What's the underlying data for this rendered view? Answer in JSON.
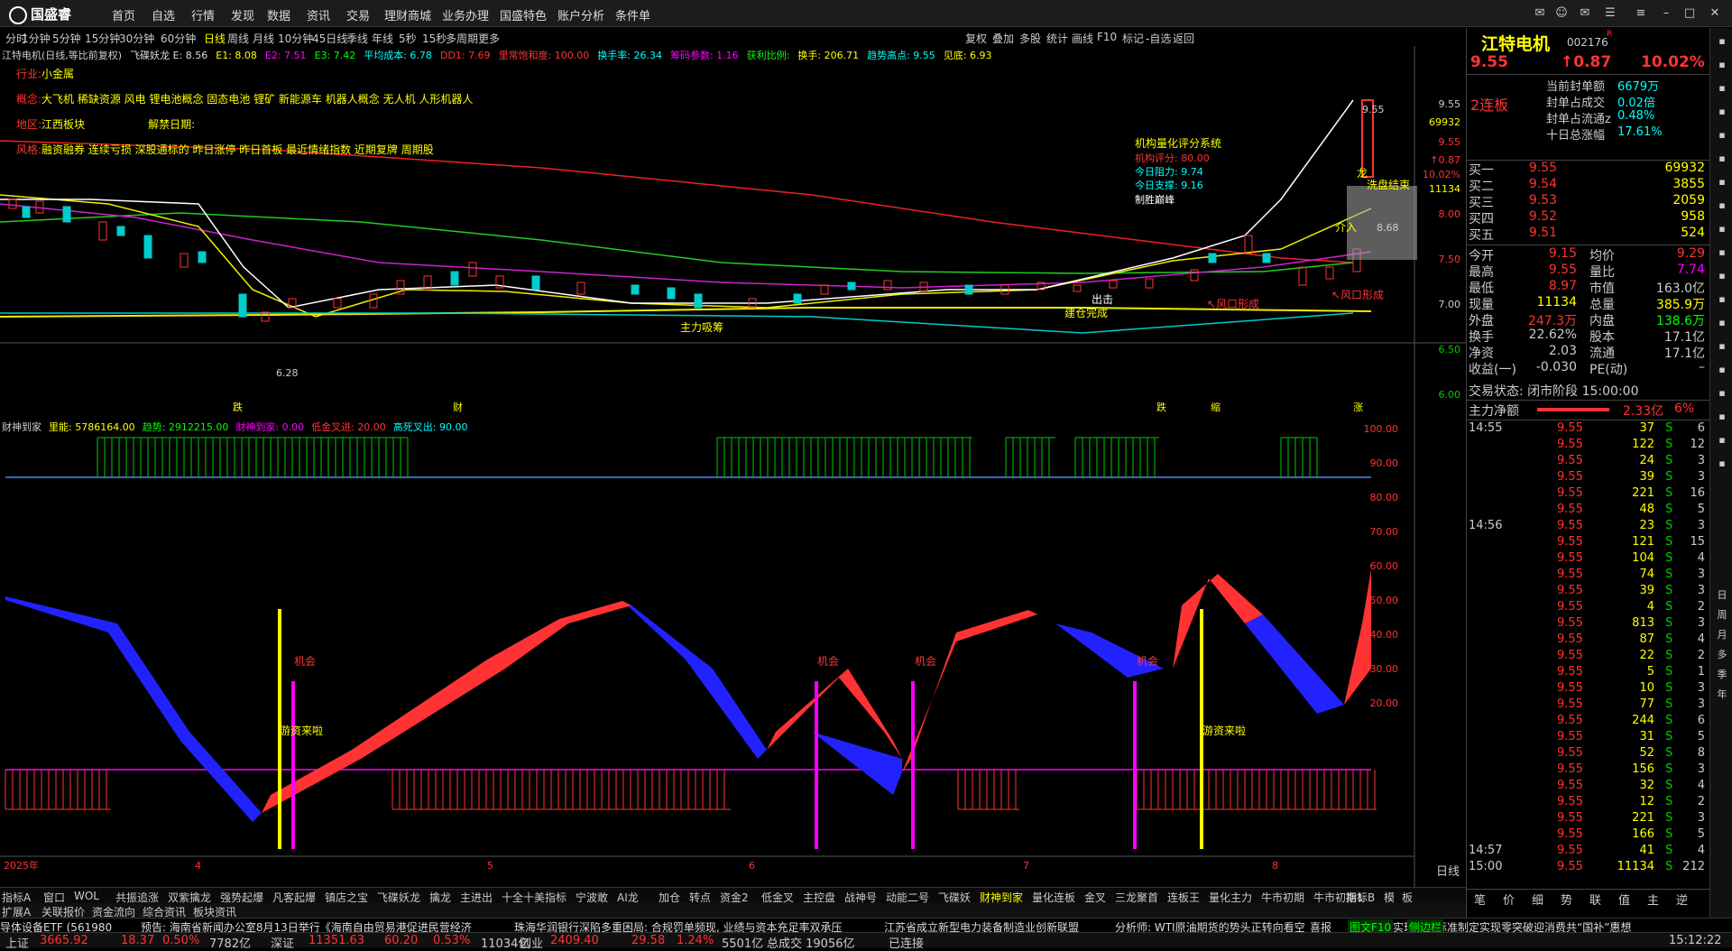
{
  "app": {
    "logo": "国盛睿",
    "menu": [
      "首页",
      "自选",
      "行情",
      "发现",
      "数据",
      "资讯",
      "交易",
      "理财商城",
      "业务办理",
      "国盛特色",
      "账户分析",
      "条件单"
    ]
  },
  "period_tabs": [
    "分时",
    "1分钟",
    "5分钟",
    "15分钟",
    "30分钟",
    "60分钟",
    "日线",
    "周线",
    "月线",
    "10分钟",
    "45日线",
    "季线",
    "年线",
    "5秒",
    "15秒",
    "多周期",
    "更多"
  ],
  "active_period": "日线",
  "toolbar": [
    "复权",
    "叠加",
    "多股",
    "统计",
    "画线",
    "F10",
    "标记",
    "-自选",
    "返回"
  ],
  "header_row": [
    {
      "t": "江特电机(日线,等比前复权)",
      "c": "#ccc"
    },
    {
      "t": "飞碟妖龙 E: 8.56",
      "c": "#ddd"
    },
    {
      "t": "E1: 8.08",
      "c": "#ff0"
    },
    {
      "t": "E2: 7.51",
      "c": "#f0f"
    },
    {
      "t": "E3: 7.42",
      "c": "#0f0"
    },
    {
      "t": "平均成本: 6.78",
      "c": "#0ff"
    },
    {
      "t": "DD1: 7.69",
      "c": "#f33"
    },
    {
      "t": "里常饱和度: 100.00",
      "c": "#f33"
    },
    {
      "t": "换手率: 26.34",
      "c": "#0ff"
    },
    {
      "t": "筹码参数: 1.16",
      "c": "#f0f"
    },
    {
      "t": "获利比例:",
      "c": "#0f0"
    },
    {
      "t": "换手: 206.71",
      "c": "#ff0"
    },
    {
      "t": "趋势高点: 9.55",
      "c": "#0ff"
    },
    {
      "t": "见底: 6.93",
      "c": "#ff0"
    }
  ],
  "info_box": {
    "industry_label": "行业:",
    "industry": "小金属",
    "concept_label": "概念:",
    "concept": "大飞机 稀缺资源 风电 锂电池概念 固态电池 锂矿 新能源车 机器人概念 无人机 人形机器人",
    "region_label": "地区:",
    "region": "江西板块",
    "unlock_label": "解禁日期:",
    "style_label": "风格:",
    "style": "融资融券 连续亏损 深股通标的 昨日涨停 昨日首板 最近情绪指数 近期复牌 周期股"
  },
  "annotations": {
    "low": "6.28",
    "high": "9.55",
    "right_low": "8.68",
    "main_absorb": "主力吸筹",
    "build_zone": "建仓完成",
    "winds_a": "↖风口形成",
    "winds_b": "↖风口形成",
    "dragon": "龙",
    "wash_end": "洗盘结束",
    "cut_in": "介入",
    "cut_in2": "出击",
    "score_title": "机构量化评分系统",
    "score_1": "机构评分: 80.00",
    "score_2": "今日阻力: 9.74",
    "score_3": "今日支撑: 9.16",
    "score_4": "制胜巅峰",
    "fall_1": "跌",
    "fall_2": "财",
    "fall_3": "跌",
    "flag_1": "缩",
    "flag_2": "涨"
  },
  "price_axis": [
    "9.55",
    "69932",
    "9.55",
    "↑0.87",
    "10.02%",
    "11134",
    "8.00",
    "7.50",
    "7.00",
    "6.50",
    "6.00"
  ],
  "sub_header": [
    {
      "t": "财神到家",
      "c": "#ccc"
    },
    {
      "t": "里能: 5786164.00",
      "c": "#ff0"
    },
    {
      "t": "趋势: 2912215.00",
      "c": "#0f0"
    },
    {
      "t": "财神到家: 0.00",
      "c": "#f0f"
    },
    {
      "t": "低金叉进: 20.00",
      "c": "#f33"
    },
    {
      "t": "高死叉出: 90.00",
      "c": "#0ff"
    }
  ],
  "sub_axis": [
    "100.00",
    "90.00",
    "80.00",
    "70.00",
    "60.00",
    "50.00",
    "40.00",
    "30.00",
    "20.00"
  ],
  "sub_labels": {
    "chance": "机会",
    "funds_come": "游资来啦"
  },
  "date_axis": [
    "2025年",
    "4",
    "5",
    "6",
    "7",
    "8"
  ],
  "date_label_right": "日线",
  "stock": {
    "name": "江特电机",
    "code": "002176",
    "suffix": "R",
    "price": "9.55",
    "change": "↑0.87",
    "pct": "10.02%",
    "board": "2连板"
  },
  "limit_info": [
    {
      "l": "当前封单额",
      "v": "6679万"
    },
    {
      "l": "封单占成交",
      "v": "0.02倍"
    },
    {
      "l": "封单占流通z",
      "v": "0.48%"
    },
    {
      "l": "十日总涨幅",
      "v": "17.61%"
    }
  ],
  "order_book": [
    {
      "l": "买一",
      "p": "9.55",
      "v": "69932"
    },
    {
      "l": "买二",
      "p": "9.54",
      "v": "3855"
    },
    {
      "l": "买三",
      "p": "9.53",
      "v": "2059"
    },
    {
      "l": "买四",
      "p": "9.52",
      "v": "958"
    },
    {
      "l": "买五",
      "p": "9.51",
      "v": "524"
    }
  ],
  "stats": [
    {
      "l": "今开",
      "v": "9.15",
      "c": "#f33",
      "l2": "均价",
      "v2": "9.29",
      "c2": "#f33"
    },
    {
      "l": "最高",
      "v": "9.55",
      "c": "#f33",
      "l2": "量比",
      "v2": "7.74",
      "c2": "#f0f"
    },
    {
      "l": "最低",
      "v": "8.97",
      "c": "#f33",
      "l2": "市值",
      "v2": "163.0亿",
      "c2": "#ccc"
    },
    {
      "l": "现量",
      "v": "11134",
      "c": "#ff0",
      "l2": "总量",
      "v2": "385.9万",
      "c2": "#ff0"
    },
    {
      "l": "外盘",
      "v": "247.3万",
      "c": "#f33",
      "l2": "内盘",
      "v2": "138.6万",
      "c2": "#0f0"
    },
    {
      "l": "换手",
      "v": "22.62%",
      "c": "#ccc",
      "l2": "股本",
      "v2": "17.1亿",
      "c2": "#ccc"
    },
    {
      "l": "净资",
      "v": "2.03",
      "c": "#ccc",
      "l2": "流通",
      "v2": "17.1亿",
      "c2": "#ccc"
    },
    {
      "l": "收益(一)",
      "v": "-0.030",
      "c": "#ccc",
      "l2": "PE(动)",
      "v2": "–",
      "c2": "#ccc"
    }
  ],
  "trade_status": "交易状态: 闭市阶段 15:00:00",
  "net_main": {
    "l": "主力净额",
    "v": "2.33亿",
    "p": "6%"
  },
  "ticks": [
    {
      "t": "14:55",
      "p": "9.55",
      "v": "37",
      "s": "S",
      "n": "6"
    },
    {
      "t": "",
      "p": "9.55",
      "v": "122",
      "s": "S",
      "n": "12"
    },
    {
      "t": "",
      "p": "9.55",
      "v": "24",
      "s": "S",
      "n": "3"
    },
    {
      "t": "",
      "p": "9.55",
      "v": "39",
      "s": "S",
      "n": "3"
    },
    {
      "t": "",
      "p": "9.55",
      "v": "221",
      "s": "S",
      "n": "16"
    },
    {
      "t": "",
      "p": "9.55",
      "v": "48",
      "s": "S",
      "n": "5"
    },
    {
      "t": "14:56",
      "p": "9.55",
      "v": "23",
      "s": "S",
      "n": "3"
    },
    {
      "t": "",
      "p": "9.55",
      "v": "121",
      "s": "S",
      "n": "15"
    },
    {
      "t": "",
      "p": "9.55",
      "v": "104",
      "s": "S",
      "n": "4"
    },
    {
      "t": "",
      "p": "9.55",
      "v": "74",
      "s": "S",
      "n": "3"
    },
    {
      "t": "",
      "p": "9.55",
      "v": "39",
      "s": "S",
      "n": "3"
    },
    {
      "t": "",
      "p": "9.55",
      "v": "4",
      "s": "S",
      "n": "2"
    },
    {
      "t": "",
      "p": "9.55",
      "v": "813",
      "s": "S",
      "n": "3"
    },
    {
      "t": "",
      "p": "9.55",
      "v": "87",
      "s": "S",
      "n": "4"
    },
    {
      "t": "",
      "p": "9.55",
      "v": "22",
      "s": "S",
      "n": "2"
    },
    {
      "t": "",
      "p": "9.55",
      "v": "5",
      "s": "S",
      "n": "1"
    },
    {
      "t": "",
      "p": "9.55",
      "v": "10",
      "s": "S",
      "n": "3"
    },
    {
      "t": "",
      "p": "9.55",
      "v": "77",
      "s": "S",
      "n": "3"
    },
    {
      "t": "",
      "p": "9.55",
      "v": "244",
      "s": "S",
      "n": "6"
    },
    {
      "t": "",
      "p": "9.55",
      "v": "31",
      "s": "S",
      "n": "5"
    },
    {
      "t": "",
      "p": "9.55",
      "v": "52",
      "s": "S",
      "n": "8"
    },
    {
      "t": "",
      "p": "9.55",
      "v": "156",
      "s": "S",
      "n": "3"
    },
    {
      "t": "",
      "p": "9.55",
      "v": "32",
      "s": "S",
      "n": "4"
    },
    {
      "t": "",
      "p": "9.55",
      "v": "12",
      "s": "S",
      "n": "2"
    },
    {
      "t": "",
      "p": "9.55",
      "v": "221",
      "s": "S",
      "n": "3"
    },
    {
      "t": "",
      "p": "9.55",
      "v": "166",
      "s": "S",
      "n": "5"
    },
    {
      "t": "14:57",
      "p": "9.55",
      "v": "41",
      "s": "S",
      "n": "4"
    },
    {
      "t": "15:00",
      "p": "9.55",
      "v": "11134",
      "s": "S",
      "n": "212"
    }
  ],
  "right_tabs": [
    "笔",
    "价",
    "细",
    "势",
    "联",
    "值",
    "主",
    "逆"
  ],
  "side_icons": [
    "日",
    "周",
    "月",
    "多",
    "季",
    "年"
  ],
  "indicator_tabs": [
    "指标A",
    "窗口",
    "WOL",
    "共振追涨",
    "双紫擒龙",
    "强势起爆",
    "凡客起爆",
    "镇店之宝",
    "飞碟妖龙",
    "擒龙",
    "主进出",
    "十全十美指标",
    "宁波敢",
    "AI龙",
    "加仓",
    "转点",
    "资金2",
    "低金叉",
    "主控盘",
    "战神号",
    "动能二号",
    "飞碟妖",
    "财神到家",
    "量化连板",
    "金叉",
    "三龙聚首",
    "连板王",
    "量化主力",
    "牛市初期",
    "牛市初期1"
  ],
  "active_indicator": "财神到家",
  "sub_tabs": [
    "扩展A",
    "关联报价",
    "资金流向",
    "综合资讯",
    "板块资讯"
  ],
  "indicator_right": [
    "指标B",
    "模",
    "板"
  ],
  "news": [
    "导体设备ETF (561980",
    "预告: 海南省新闻办公室8月13日举行《海南自由贸易港促进民营经济",
    "珠海华润银行深陷多重困局: 合规罚单频现, 业绩与资本充足率双承压",
    "江苏省成立新型电力装备制造业创新联盟",
    "分析师: WTI原油期货的势头正转向看空",
    "喜报",
    "中钢天源实现国际标准制定实现零突破",
    "迎消费共“国补”惠想"
  ],
  "news_tag": "图文F10",
  "news_tag2": "侧边栏",
  "market": [
    {
      "n": "上证",
      "v": "3665.92",
      "c": "18.37",
      "p": "0.50%",
      "a": "7782亿"
    },
    {
      "n": "深证",
      "v": "11351.63",
      "c": "60.20",
      "p": "0.53%",
      "a": "11034亿"
    },
    {
      "n": "创业",
      "v": "2409.40",
      "c": "29.58",
      "p": "1.24%",
      "a": "5501亿"
    }
  ],
  "total_amount": "总成交 19056亿",
  "connected": "已连接",
  "clock": "15:12:22"
}
